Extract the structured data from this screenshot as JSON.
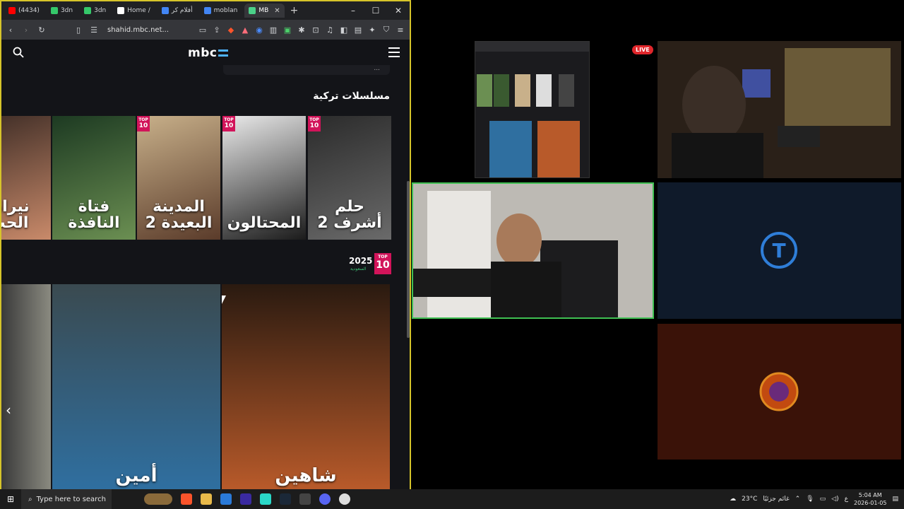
{
  "browser": {
    "tabs": [
      {
        "label": "(4434)",
        "color": "#ff0000"
      },
      {
        "label": "3dn",
        "color": "#35c86a"
      },
      {
        "label": "3dn",
        "color": "#35c86a"
      },
      {
        "label": "Home /",
        "color": "#ffffff"
      },
      {
        "label": "أفلام كر",
        "color": "#4285f4"
      },
      {
        "label": "moblan",
        "color": "#4285f4"
      },
      {
        "label": "MB",
        "color": "#4bd189",
        "active": true
      }
    ],
    "new_tab": "+",
    "url": "shahid.mbc.net...",
    "window_controls": {
      "minimize": "–",
      "maximize": "☐",
      "close": "✕"
    }
  },
  "site": {
    "logo": "mbc",
    "top_strip_text": "...",
    "section_title": "مسلسلات تركية",
    "posters": [
      {
        "title": "نيران الحب",
        "colors": [
          "#3a2a24",
          "#c98a6a"
        ],
        "top10": false
      },
      {
        "title": "فتاة النافذة",
        "colors": [
          "#1d3a22",
          "#6b8f52"
        ],
        "top10": false
      },
      {
        "title": "المدينة البعيدة 2",
        "colors": [
          "#c8b08a",
          "#5a3b2a"
        ],
        "top10": true
      },
      {
        "title": "المحتالون",
        "colors": [
          "#eaeaea",
          "#1b1b1b"
        ],
        "top10": true
      },
      {
        "title": "حلم أشرف 2",
        "colors": [
          "#2b2b2b",
          "#6a6a6a"
        ],
        "top10": true
      }
    ],
    "top10_badge": {
      "top": "TOP",
      "num": "10"
    },
    "year": "2025",
    "year_sub": "السعودية",
    "big_posters": [
      {
        "title": "أمين",
        "colors": [
          "#3a4a50",
          "#2f6fa0"
        ]
      },
      {
        "title": "شاهين",
        "colors": [
          "#2a1a10",
          "#b85a2a"
        ]
      }
    ],
    "arrow_left": "‹"
  },
  "stream": {
    "live_label": "LIVE"
  },
  "taskbar": {
    "search_placeholder": "Type here to search",
    "weather": "23°C",
    "weather_desc": "غائم جزئيًا",
    "lang": "ع",
    "time": "5:04 AM",
    "date": "2026-01-05"
  }
}
